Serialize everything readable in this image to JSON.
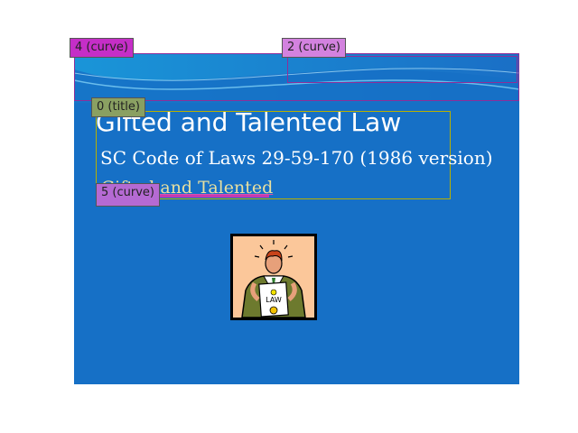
{
  "slide": {
    "title": "Gifted and Talented Law",
    "subtitle": "SC Code of Laws 29-59-170 (1986 version)",
    "link_text": "Gifted and Talented",
    "background_color": "#1670c6",
    "clipart_label": "LAW"
  },
  "annotations": [
    {
      "label": "4 (curve)"
    },
    {
      "label": "2 (curve)"
    },
    {
      "label": "0 (title)"
    },
    {
      "label": "5 (curve)"
    }
  ]
}
